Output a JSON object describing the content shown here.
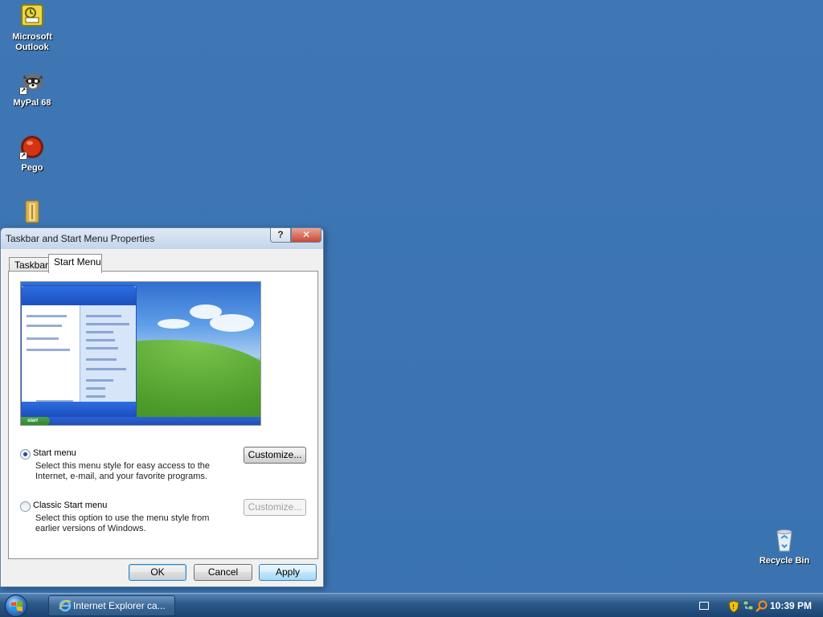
{
  "desktop": {
    "icons": [
      {
        "label": "Microsoft Outlook",
        "icon": "outlook-icon"
      },
      {
        "label": "MyPal 68",
        "icon": "raccoon-icon"
      },
      {
        "label": "Pego",
        "icon": "pego-icon"
      },
      {
        "label": "",
        "icon": "folder-icon"
      },
      {
        "label": "Recycle Bin",
        "icon": "recycle-bin-icon"
      }
    ]
  },
  "dialog": {
    "title": "Taskbar and Start Menu Properties",
    "help_label": "?",
    "close_label": "✕",
    "tabs": [
      {
        "label": "Taskbar",
        "active": false
      },
      {
        "label": "Start Menu",
        "active": true
      }
    ],
    "preview": {
      "start_label": "start"
    },
    "options": [
      {
        "label": "Start menu",
        "checked": true,
        "description": "Select this menu style for easy access to the Internet, e-mail, and your favorite programs.",
        "customize_label": "Customize...",
        "customize_enabled": true
      },
      {
        "label": "Classic Start menu",
        "checked": false,
        "description": "Select this option to use the menu style from earlier versions of Windows.",
        "customize_label": "Customize...",
        "customize_enabled": false
      }
    ],
    "buttons": {
      "ok": "OK",
      "cancel": "Cancel",
      "apply": "Apply"
    }
  },
  "taskbar": {
    "task_button_label": "Internet Explorer ca...",
    "clock": "10:39 PM",
    "tray_icons": [
      "keyboard-icon",
      "security-shield-icon",
      "network-icon",
      "search-icon"
    ]
  },
  "colors": {
    "desktop_background": "#3a73b0",
    "dialog_background": "#f0f0f0",
    "taskbar": "#1a4372"
  }
}
